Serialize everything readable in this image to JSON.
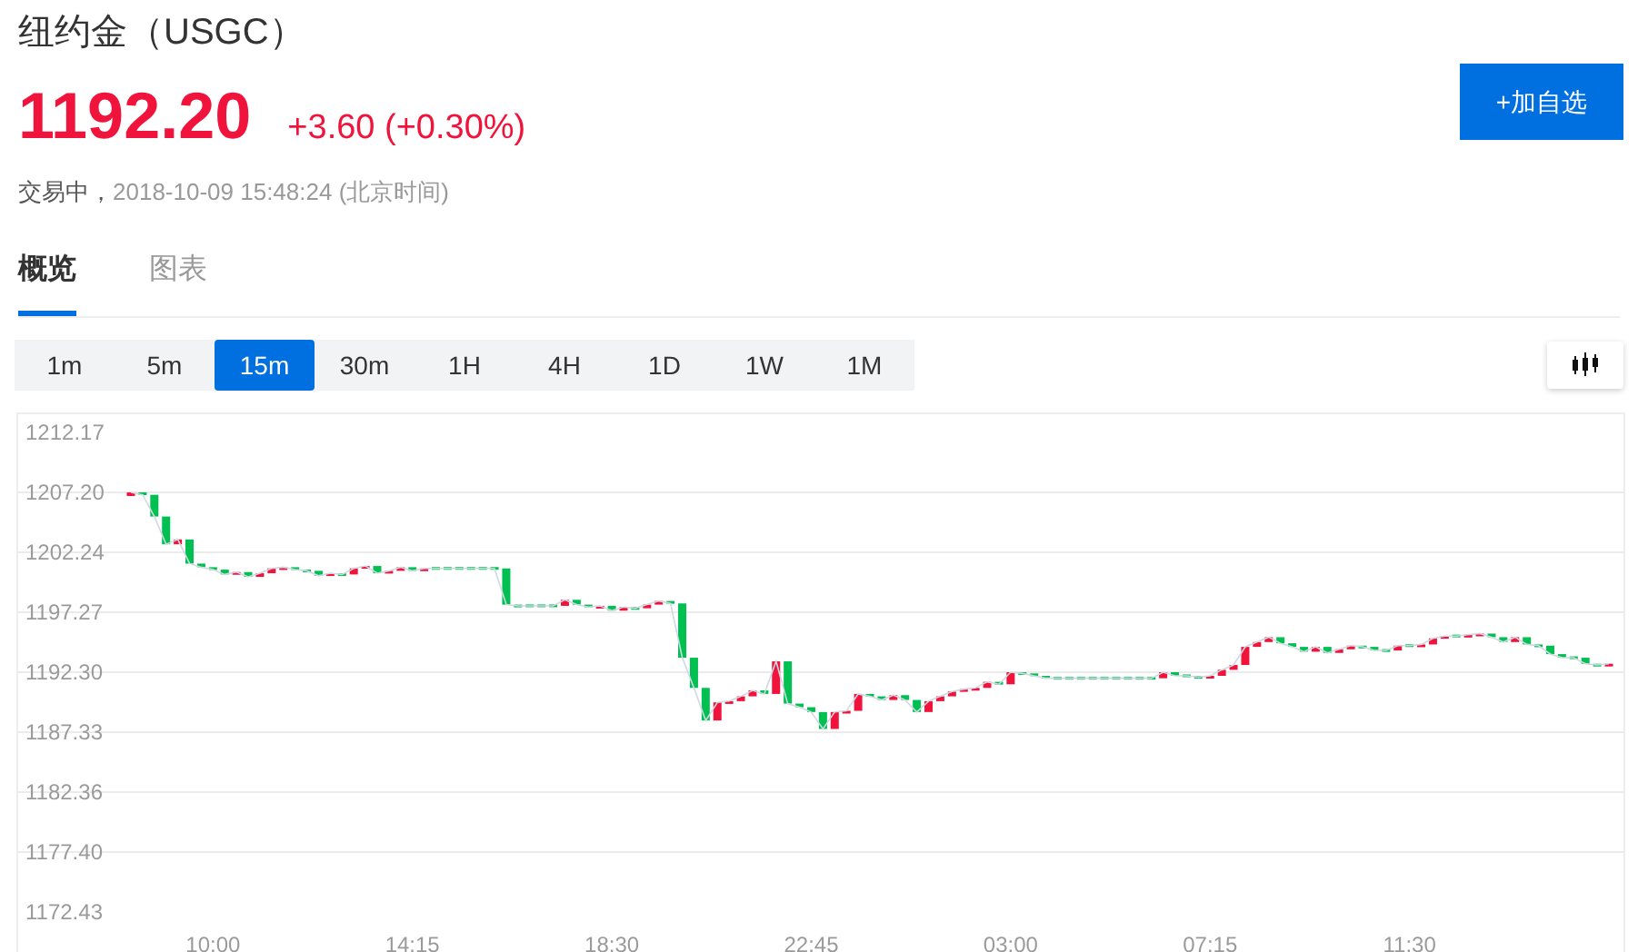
{
  "header": {
    "title": "纽约金（USGC）",
    "price": "1192.20",
    "change": "+3.60 (+0.30%)",
    "status": "交易中，",
    "timestamp": "2018-10-09 15:48:24 (北京时间)",
    "watchlist_button": "+加自选"
  },
  "tabs": [
    {
      "label": "概览",
      "selected": true
    },
    {
      "label": "图表",
      "selected": false
    }
  ],
  "periods": [
    {
      "label": "1m",
      "selected": false
    },
    {
      "label": "5m",
      "selected": false
    },
    {
      "label": "15m",
      "selected": true
    },
    {
      "label": "30m",
      "selected": false
    },
    {
      "label": "1H",
      "selected": false
    },
    {
      "label": "4H",
      "selected": false
    },
    {
      "label": "1D",
      "selected": false
    },
    {
      "label": "1W",
      "selected": false
    },
    {
      "label": "1M",
      "selected": false
    }
  ],
  "chart": {
    "chart_data": {
      "type": "line",
      "grid": true,
      "ylim": [
        1172.43,
        1212.17
      ],
      "yticks": [
        {
          "value": 1212.17,
          "label": "1212.17"
        },
        {
          "value": 1207.2,
          "label": "1207.20"
        },
        {
          "value": 1202.24,
          "label": "1202.24"
        },
        {
          "value": 1197.27,
          "label": "1197.27"
        },
        {
          "value": 1192.3,
          "label": "1192.30"
        },
        {
          "value": 1187.33,
          "label": "1187.33"
        },
        {
          "value": 1182.36,
          "label": "1182.36"
        },
        {
          "value": 1177.4,
          "label": "1177.40"
        },
        {
          "value": 1172.43,
          "label": "1172.43"
        }
      ],
      "categories": [
        null,
        null,
        null,
        null,
        null,
        null,
        null,
        "10:00",
        null,
        null,
        null,
        null,
        null,
        null,
        null,
        null,
        null,
        null,
        null,
        null,
        null,
        null,
        null,
        null,
        "14:15",
        null,
        null,
        null,
        null,
        null,
        null,
        null,
        null,
        null,
        null,
        null,
        null,
        null,
        null,
        null,
        null,
        "18:30",
        null,
        null,
        null,
        null,
        null,
        null,
        null,
        null,
        null,
        null,
        null,
        null,
        null,
        null,
        null,
        null,
        "22:45",
        null,
        null,
        null,
        null,
        null,
        null,
        null,
        null,
        null,
        null,
        null,
        null,
        null,
        null,
        null,
        null,
        "03:00",
        null,
        null,
        null,
        null,
        null,
        null,
        null,
        null,
        null,
        null,
        null,
        null,
        null,
        null,
        null,
        null,
        "07:15",
        null,
        null,
        null,
        null,
        null,
        null,
        null,
        null,
        null,
        null,
        null,
        null,
        null,
        null,
        null,
        null,
        "11:30",
        null,
        null,
        null,
        null,
        null,
        null,
        null,
        null,
        null,
        null,
        null,
        null,
        null,
        null,
        null,
        null,
        null
      ],
      "series": [
        {
          "values": [
            1207.2,
            1207.0,
            1205.2,
            1202.9,
            1203.3,
            1201.3,
            1201.0,
            1200.8,
            1200.4,
            1200.6,
            1200.2,
            1200.5,
            1200.9,
            1201.0,
            1200.8,
            1200.7,
            1200.3,
            1200.5,
            1200.4,
            1200.9,
            1201.1,
            1200.5,
            1200.7,
            1201.0,
            1200.7,
            1200.9,
            1200.9,
            1200.9,
            1200.9,
            1200.9,
            1200.9,
            1200.9,
            1197.9,
            1197.8,
            1197.8,
            1197.8,
            1197.8,
            1198.3,
            1197.9,
            1197.7,
            1197.8,
            1197.4,
            1197.7,
            1197.6,
            1197.9,
            1198.2,
            1198.0,
            1193.5,
            1191.0,
            1188.3,
            1189.8,
            1189.9,
            1190.3,
            1190.8,
            1190.5,
            1193.2,
            1189.7,
            1189.4,
            1189.0,
            1187.6,
            1189.0,
            1189.1,
            1190.5,
            1190.3,
            1190.0,
            1190.4,
            1190.0,
            1189.0,
            1189.9,
            1190.3,
            1190.7,
            1190.9,
            1191.0,
            1191.5,
            1191.3,
            1192.3,
            1192.2,
            1192.0,
            1191.8,
            1191.8,
            1191.8,
            1191.8,
            1191.8,
            1191.8,
            1191.8,
            1191.8,
            1191.8,
            1191.8,
            1192.3,
            1192.0,
            1192.0,
            1191.9,
            1192.0,
            1192.5,
            1192.9,
            1194.4,
            1194.8,
            1195.2,
            1194.7,
            1194.4,
            1194.0,
            1194.4,
            1193.9,
            1194.2,
            1194.5,
            1194.4,
            1194.1,
            1194.1,
            1194.5,
            1194.5,
            1194.6,
            1195.1,
            1195.3,
            1195.3,
            1195.4,
            1195.5,
            1195.2,
            1194.8,
            1195.2,
            1194.6,
            1194.5,
            1193.8,
            1193.5,
            1193.5,
            1193.0,
            1192.9,
            1193.0
          ]
        }
      ]
    }
  }
}
